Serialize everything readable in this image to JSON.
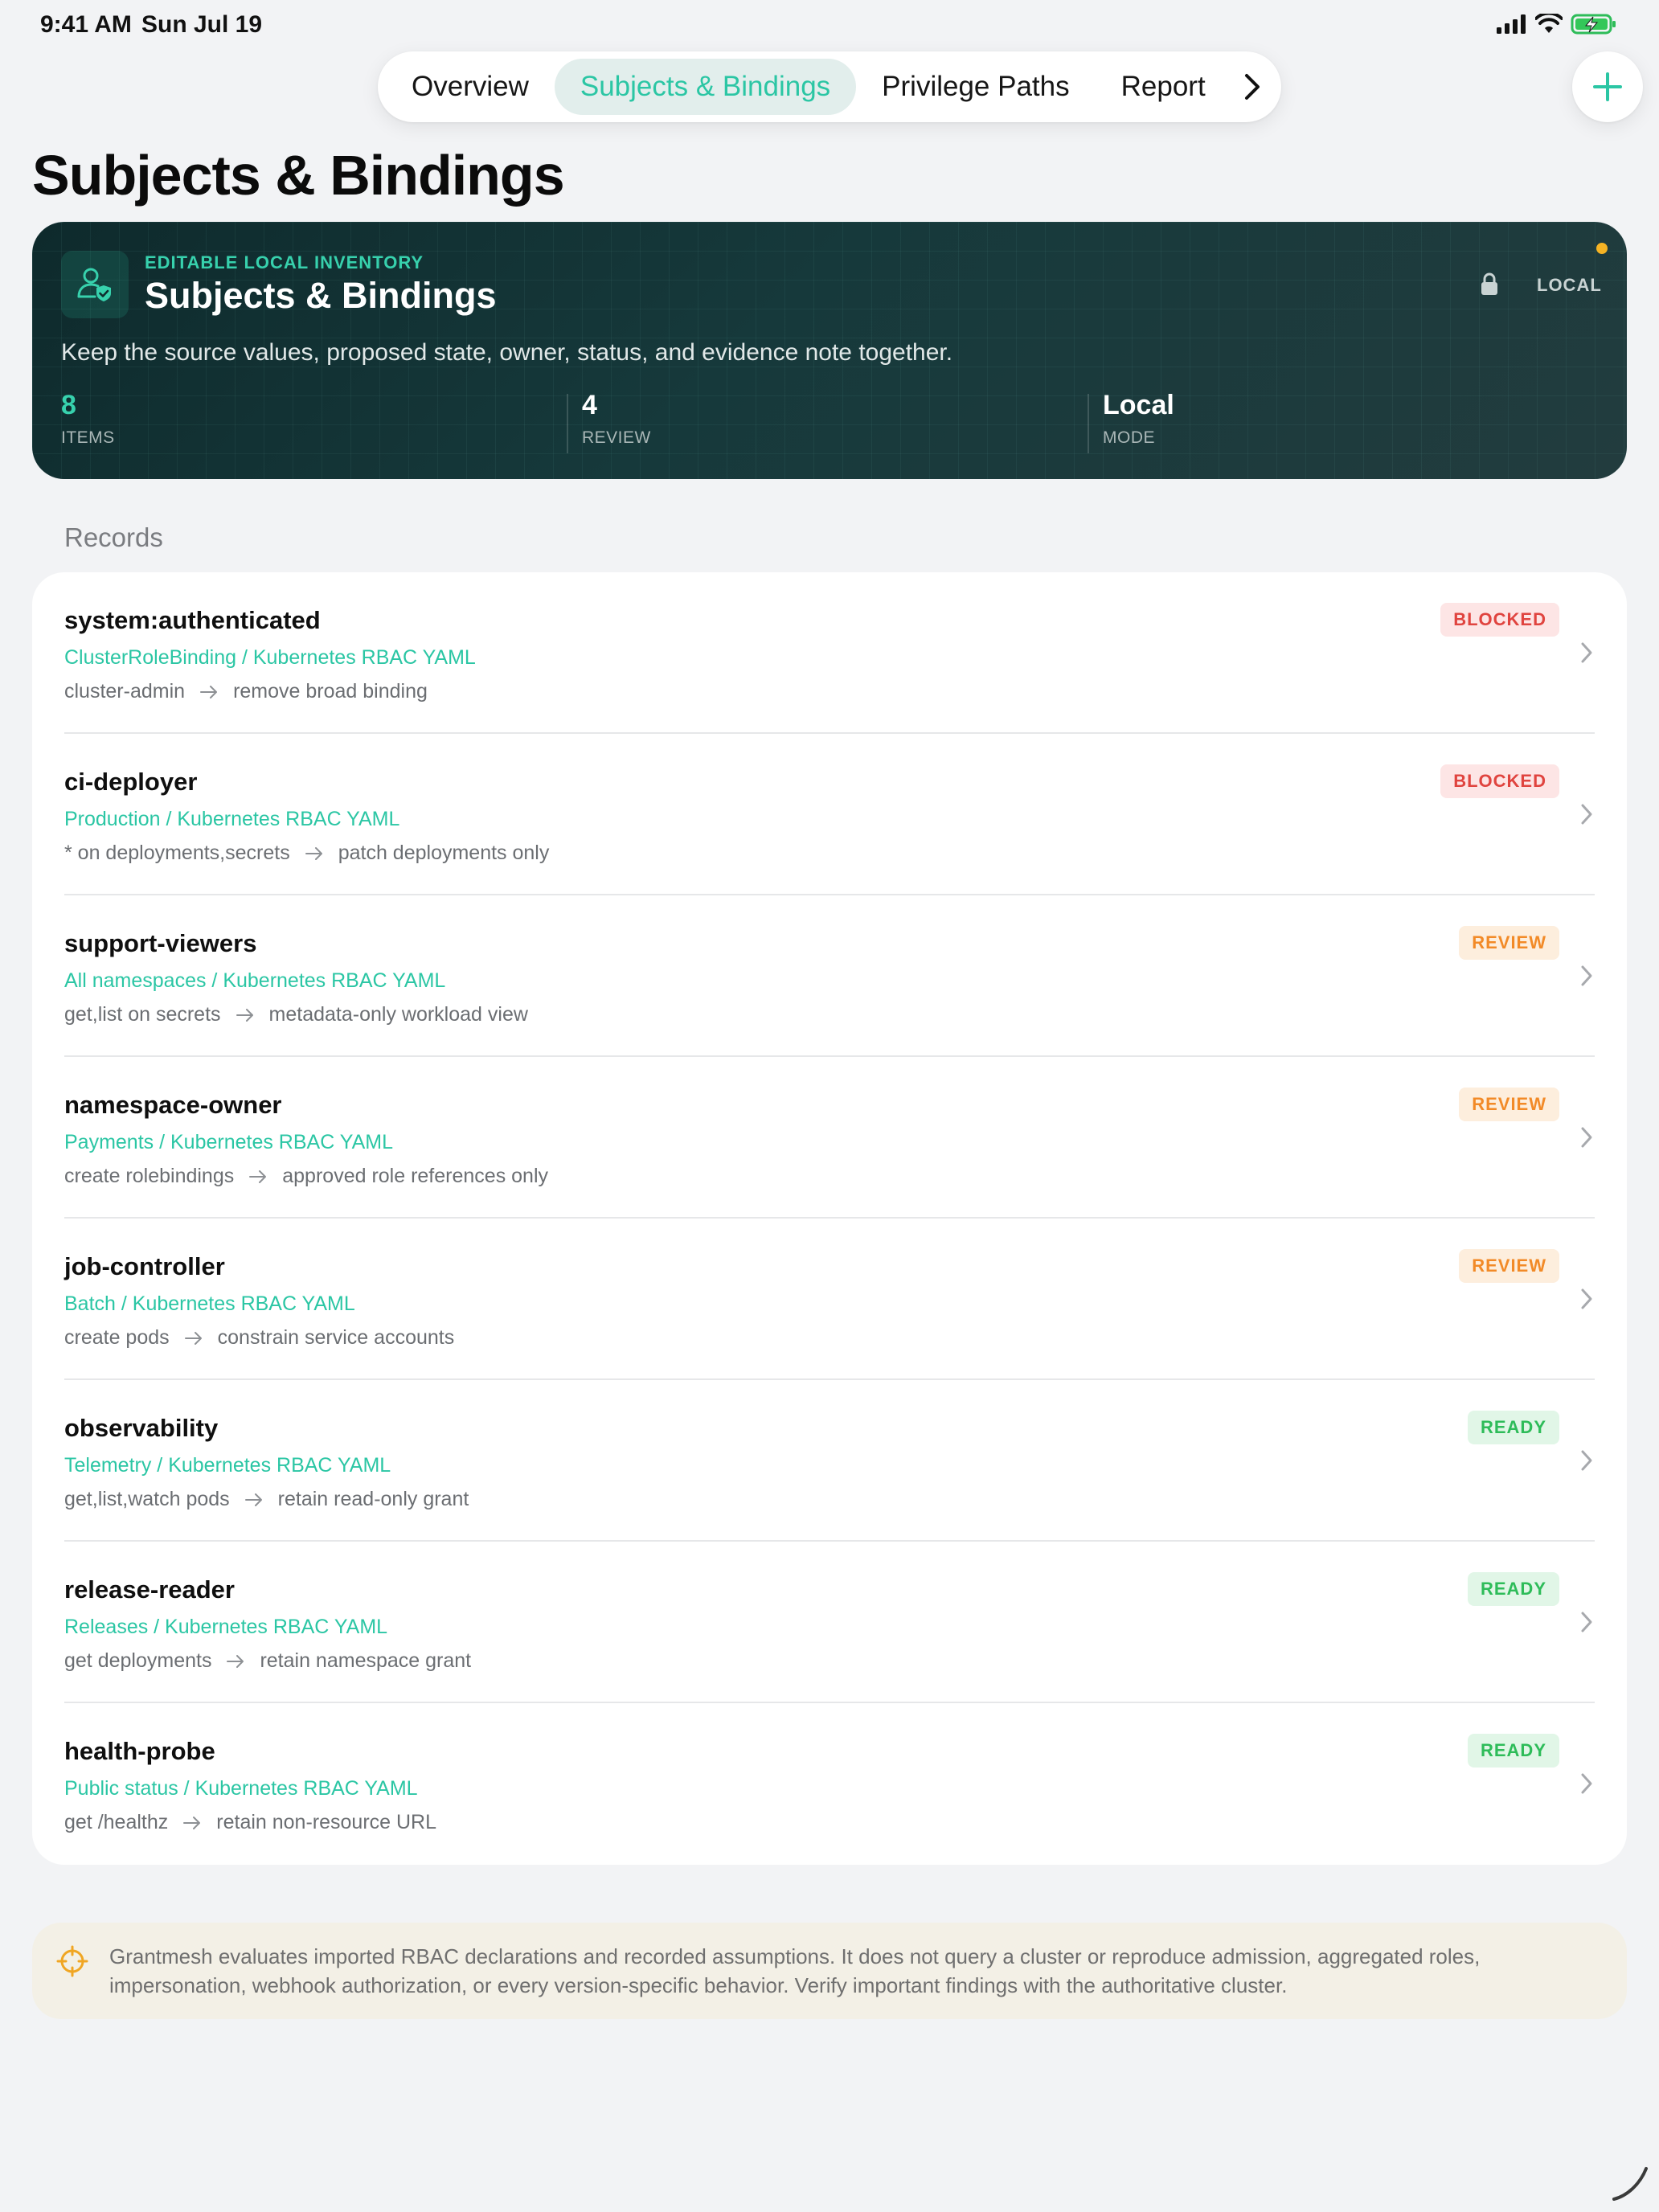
{
  "status_bar": {
    "time": "9:41 AM",
    "date": "Sun Jul 19"
  },
  "tabs": [
    {
      "label": "Overview",
      "active": false
    },
    {
      "label": "Subjects & Bindings",
      "active": true
    },
    {
      "label": "Privilege Paths",
      "active": false
    },
    {
      "label": "Report",
      "active": false
    }
  ],
  "page": {
    "title": "Subjects & Bindings"
  },
  "hero": {
    "eyebrow": "EDITABLE LOCAL INVENTORY",
    "title": "Subjects & Bindings",
    "mode_badge": "LOCAL",
    "description": "Keep the source values, proposed state, owner, status, and evidence note together.",
    "stats": [
      {
        "value": "8",
        "label": "ITEMS"
      },
      {
        "value": "4",
        "label": "REVIEW"
      },
      {
        "value": "Local",
        "label": "MODE"
      }
    ]
  },
  "records": {
    "section_label": "Records",
    "items": [
      {
        "name": "system:authenticated",
        "scope": "ClusterRoleBinding / Kubernetes RBAC YAML",
        "from": "cluster-admin",
        "to": "remove broad binding",
        "status": "BLOCKED"
      },
      {
        "name": "ci-deployer",
        "scope": "Production / Kubernetes RBAC YAML",
        "from": "* on deployments,secrets",
        "to": "patch deployments only",
        "status": "BLOCKED"
      },
      {
        "name": "support-viewers",
        "scope": "All namespaces / Kubernetes RBAC YAML",
        "from": "get,list on secrets",
        "to": "metadata-only workload view",
        "status": "REVIEW"
      },
      {
        "name": "namespace-owner",
        "scope": "Payments / Kubernetes RBAC YAML",
        "from": "create rolebindings",
        "to": "approved role references only",
        "status": "REVIEW"
      },
      {
        "name": "job-controller",
        "scope": "Batch / Kubernetes RBAC YAML",
        "from": "create pods",
        "to": "constrain service accounts",
        "status": "REVIEW"
      },
      {
        "name": "observability",
        "scope": "Telemetry / Kubernetes RBAC YAML",
        "from": "get,list,watch pods",
        "to": "retain read-only grant",
        "status": "READY"
      },
      {
        "name": "release-reader",
        "scope": "Releases / Kubernetes RBAC YAML",
        "from": "get deployments",
        "to": "retain namespace grant",
        "status": "READY"
      },
      {
        "name": "health-probe",
        "scope": "Public status / Kubernetes RBAC YAML",
        "from": "get /healthz",
        "to": "retain non-resource URL",
        "status": "READY"
      }
    ]
  },
  "disclaimer": {
    "text": "Grantmesh evaluates imported RBAC declarations and recorded assumptions. It does not query a cluster or reproduce admission, aggregated roles, impersonation, webhook authorization, or every version-specific behavior. Verify important findings with the authoritative cluster."
  },
  "colors": {
    "accent": "#2bc6a4",
    "blocked": "#e0443f",
    "review": "#f28a27",
    "ready": "#2ebc59",
    "hero_bg": "#16393b"
  }
}
